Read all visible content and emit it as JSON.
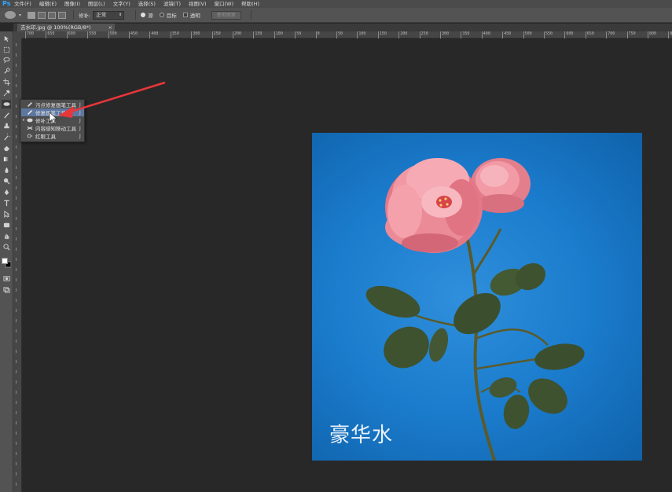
{
  "app": {
    "logo": "Ps"
  },
  "menu": [
    "文件(F)",
    "编辑(E)",
    "图像(I)",
    "图层(L)",
    "文字(Y)",
    "选择(S)",
    "滤镜(T)",
    "视图(V)",
    "窗口(W)",
    "帮助(H)"
  ],
  "options": {
    "mode_label": "修补:",
    "mode_value": "正常",
    "source_label": "源",
    "target_label": "目标",
    "transparent_label": "透明",
    "use_pattern_label": "使用图案"
  },
  "document_tab": {
    "title": "去水印.jpg @ 100%(RGB/8*)",
    "close": "×"
  },
  "ruler_labels": [
    "700",
    "650",
    "600",
    "550",
    "500",
    "450",
    "400",
    "350",
    "300",
    "250",
    "200",
    "150",
    "100",
    "50",
    "0",
    "50",
    "100",
    "150",
    "200",
    "250",
    "300",
    "350",
    "400",
    "450",
    "500",
    "550",
    "600",
    "650",
    "700",
    "750",
    "800",
    "850"
  ],
  "flyout": {
    "items": [
      {
        "label": "污点修复画笔工具",
        "key": "J",
        "active": false
      },
      {
        "label": "修复画笔工具",
        "key": "J",
        "active": false
      },
      {
        "label": "修补工具",
        "key": "J",
        "active": true
      },
      {
        "label": "内容感知移动工具",
        "key": "J",
        "active": false
      },
      {
        "label": "红眼工具",
        "key": "J",
        "active": false
      }
    ],
    "bullet": "•"
  },
  "canvas": {
    "watermark_text": "豪华水",
    "background_color": "#1b7ccd"
  },
  "icons": [
    "move-icon",
    "marquee-icon",
    "lasso-icon",
    "quick-select-icon",
    "crop-icon",
    "eyedropper-icon",
    "healing-brush-icon",
    "brush-icon",
    "clone-stamp-icon",
    "history-brush-icon",
    "eraser-icon",
    "gradient-icon",
    "blur-icon",
    "dodge-icon",
    "pen-icon",
    "type-icon",
    "path-select-icon",
    "shape-icon",
    "hand-icon",
    "zoom-icon",
    "color-swatch-icon",
    "quick-mask-icon",
    "screen-mode-icon"
  ],
  "colors": {
    "accent": "#31a8ff",
    "annotation": "#e8363a",
    "highlight": "#5e77a0"
  }
}
